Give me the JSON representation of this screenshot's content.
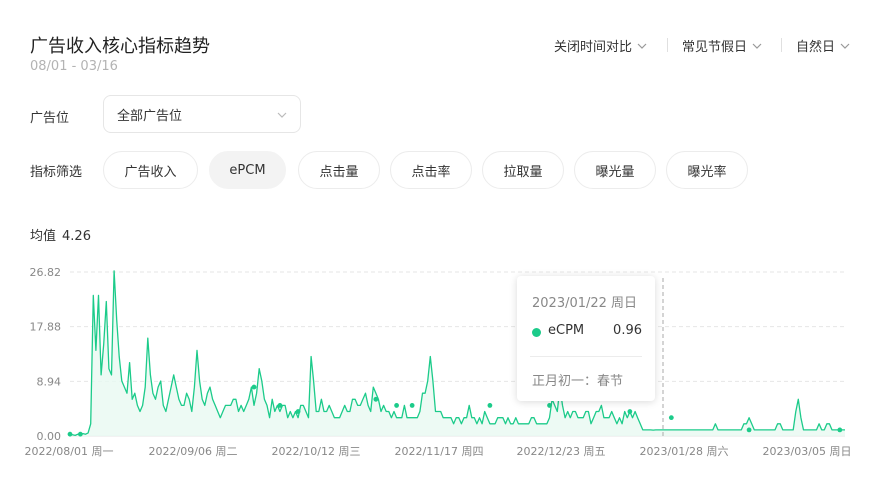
{
  "header": {
    "title": "广告收入核心指标趋势",
    "date_range": "08/01 - 03/16",
    "dropdowns": [
      "关闭时间对比",
      "常见节假日",
      "自然日"
    ]
  },
  "filters": {
    "slot_label": "广告位",
    "slot_value": "全部广告位",
    "metric_label": "指标筛选",
    "metrics": [
      "广告收入",
      "ePCM",
      "点击量",
      "点击率",
      "拉取量",
      "曝光量",
      "曝光率"
    ],
    "active_metric": "ePCM"
  },
  "summary": {
    "avg_label": "均值",
    "avg_value": "4.26"
  },
  "tooltip": {
    "date": "2023/01/22 周日",
    "series": "eCPM",
    "value": "0.96",
    "note": "正月初一：春节"
  },
  "colors": {
    "line": "#1ccb8a",
    "area": "#e8f9f1",
    "grid": "#e6e6e6",
    "axis_text": "#888888"
  },
  "chart_data": {
    "type": "line",
    "series": [
      {
        "name": "eCPM",
        "values": [
          0.3,
          0.2,
          0.1,
          0.3,
          0.2,
          0.4,
          0.3,
          0.5,
          2,
          23,
          14,
          23,
          10,
          15,
          22,
          11,
          10,
          27,
          19,
          13,
          9,
          8,
          7,
          12,
          6,
          7,
          5,
          4,
          5,
          8,
          16,
          10,
          7,
          6,
          8,
          9,
          5,
          4,
          6,
          8,
          10,
          8,
          6,
          5,
          5,
          7,
          6,
          4,
          8,
          14,
          9,
          6,
          5,
          7,
          8,
          6,
          5,
          4,
          3,
          4,
          5,
          5,
          5,
          6,
          6,
          4,
          5,
          4,
          5,
          6,
          8,
          5,
          7,
          11,
          9,
          6,
          5,
          3,
          6,
          4,
          5,
          4,
          5,
          5,
          3,
          4,
          3,
          4,
          3,
          5,
          5,
          4,
          3,
          13,
          9,
          4,
          4,
          6,
          4,
          4,
          5,
          4,
          3,
          3,
          3,
          4,
          5,
          4,
          4,
          6,
          6,
          5,
          5,
          6,
          7,
          5,
          4,
          8,
          7,
          6,
          4,
          5,
          4,
          4,
          3,
          4,
          3,
          3,
          3,
          5,
          3,
          3,
          3,
          3,
          3,
          4,
          7,
          7,
          9,
          13,
          9,
          4,
          4,
          4,
          3,
          3,
          3,
          3,
          2,
          3,
          3,
          2,
          3,
          3,
          5,
          3,
          3,
          2,
          3,
          2,
          4,
          3,
          2,
          2,
          2,
          3,
          3,
          3,
          2,
          3,
          2,
          2,
          3,
          2,
          2,
          2,
          2,
          2,
          3,
          3,
          2,
          2,
          2,
          2,
          2,
          3,
          6,
          5,
          4,
          8,
          5,
          3,
          4,
          3,
          4,
          4,
          3,
          3,
          3,
          4,
          4,
          2,
          3,
          4,
          4,
          5,
          3,
          3,
          3,
          4,
          3,
          2,
          3,
          2,
          4,
          3,
          4,
          3,
          4,
          3,
          2,
          1,
          1,
          1,
          1,
          0.96,
          1,
          1,
          1,
          1,
          1,
          1,
          1,
          1,
          1,
          1,
          1,
          1,
          1,
          1,
          1,
          1,
          1,
          1,
          1,
          1,
          1,
          1,
          1,
          2,
          1,
          1,
          1,
          1,
          1,
          1,
          1,
          1,
          1,
          1,
          2,
          2,
          3,
          2,
          1,
          1,
          1,
          1,
          1,
          1,
          1,
          1,
          1,
          2,
          2,
          1,
          1,
          1,
          1,
          1,
          4,
          6,
          3,
          1,
          1,
          1,
          1,
          1,
          1,
          2,
          1,
          1,
          2,
          2,
          1,
          1,
          1,
          1,
          1,
          1
        ]
      }
    ],
    "markers": [
      {
        "i": 0,
        "v": 0.3
      },
      {
        "i": 4,
        "v": 0.3
      },
      {
        "i": 71,
        "v": 8
      },
      {
        "i": 81,
        "v": 5
      },
      {
        "i": 88,
        "v": 4
      },
      {
        "i": 118,
        "v": 6
      },
      {
        "i": 126,
        "v": 5
      },
      {
        "i": 132,
        "v": 5
      },
      {
        "i": 162,
        "v": 5
      },
      {
        "i": 185,
        "v": 5
      },
      {
        "i": 200,
        "v": 8
      },
      {
        "i": 216,
        "v": 4
      },
      {
        "i": 232,
        "v": 3
      },
      {
        "i": 262,
        "v": 1
      },
      {
        "i": 297,
        "v": 1
      },
      {
        "i": 321,
        "v": 1
      },
      {
        "i": 356,
        "v": 1
      },
      {
        "i": 381,
        "v": 1
      },
      {
        "i": 390,
        "v": 1
      }
    ],
    "x_ticks": [
      "2022/08/01 周一",
      "2022/09/06 周二",
      "2022/10/12 周三",
      "2022/11/17 周四",
      "2022/12/23 周五",
      "2023/01/28 周六",
      "2023/03/05 周日"
    ],
    "y_ticks": [
      "0.00",
      "8.94",
      "17.88",
      "26.82"
    ],
    "ylim": [
      0,
      26.82
    ],
    "highlight_date": "2023/01/22 周日"
  }
}
